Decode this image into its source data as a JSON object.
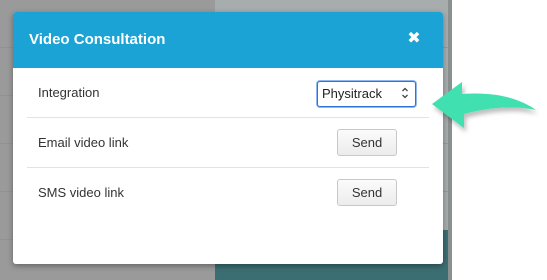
{
  "modal": {
    "title": "Video Consultation",
    "close_symbol": "✖",
    "rows": [
      {
        "label": "Integration",
        "control": "select",
        "value": "Physitrack"
      },
      {
        "label": "Email video link",
        "control": "button",
        "button_label": "Send"
      },
      {
        "label": "SMS video link",
        "control": "button",
        "button_label": "Send"
      }
    ]
  },
  "colors": {
    "header": "#1aa3d4",
    "arrow": "#3fe0b0",
    "select_border": "#2d72d6"
  },
  "icons": {
    "close": "close-icon",
    "select": "updown-chevron-icon",
    "annotation": "curved-arrow-icon"
  }
}
